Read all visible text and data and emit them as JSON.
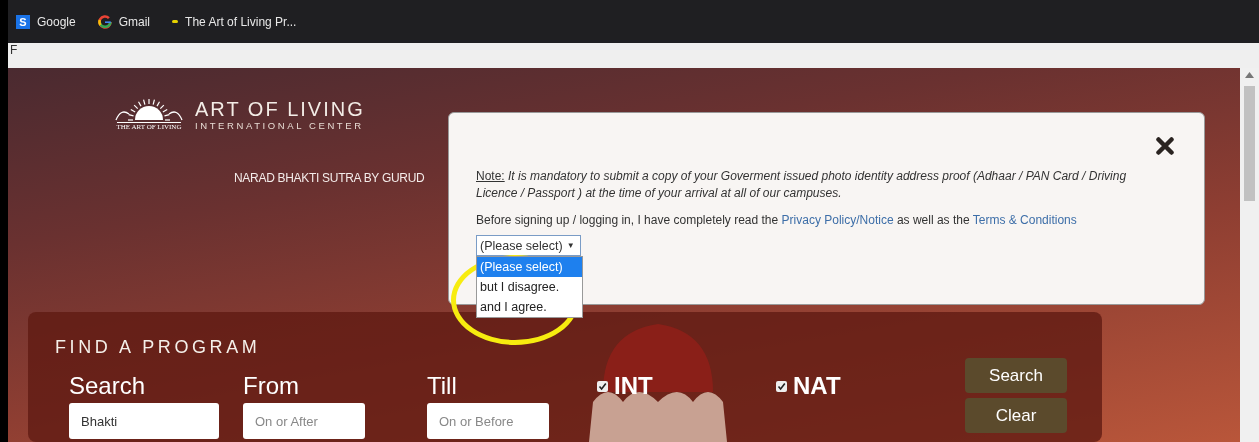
{
  "bookmarks": [
    {
      "label": "Google",
      "kind": "letter",
      "icon_text": "S"
    },
    {
      "label": "Gmail",
      "kind": "g"
    },
    {
      "label": "The Art of Living Pr...",
      "kind": "dot"
    }
  ],
  "address_bar": {
    "text": "F"
  },
  "logo": {
    "emblem_text": "THE ART OF LIVING",
    "title": "ART OF LIVING",
    "subtitle": "INTERNATIONAL CENTER"
  },
  "nav": {
    "text": "NARAD BHAKTI SUTRA BY GURUD"
  },
  "modal": {
    "note_label": "Note:",
    "note_text": "It is mandatory to submit a copy of your Goverment issued photo identity address proof (Adhaar / PAN Card / Driving Licence / Passport ) at the time of your arrival at all of our campuses.",
    "consent": {
      "before": "Before signing up / logging in, I have completely read the",
      "link_1": "Privacy Policy/Notice",
      "middle": "as well as the",
      "link_2": "Terms & Conditions"
    },
    "select": {
      "value": "(Please select)",
      "arrow": "▼",
      "expanded": true,
      "options": [
        {
          "label": "(Please select)",
          "selected": true
        },
        {
          "label": "but I disagree.",
          "selected": false
        },
        {
          "label": "and I agree.",
          "selected": false
        }
      ]
    }
  },
  "find_program": {
    "title": "FIND A PROGRAM",
    "fields": [
      {
        "label": "Search",
        "value": "Bhakti"
      },
      {
        "label": "From",
        "placeholder": "On or After"
      },
      {
        "label": "Till",
        "placeholder": "On or Before"
      }
    ],
    "filters": [
      {
        "label": "INT",
        "checked": true
      },
      {
        "label": "NAT",
        "checked": true
      }
    ],
    "buttons": [
      "Search",
      "Clear"
    ]
  }
}
